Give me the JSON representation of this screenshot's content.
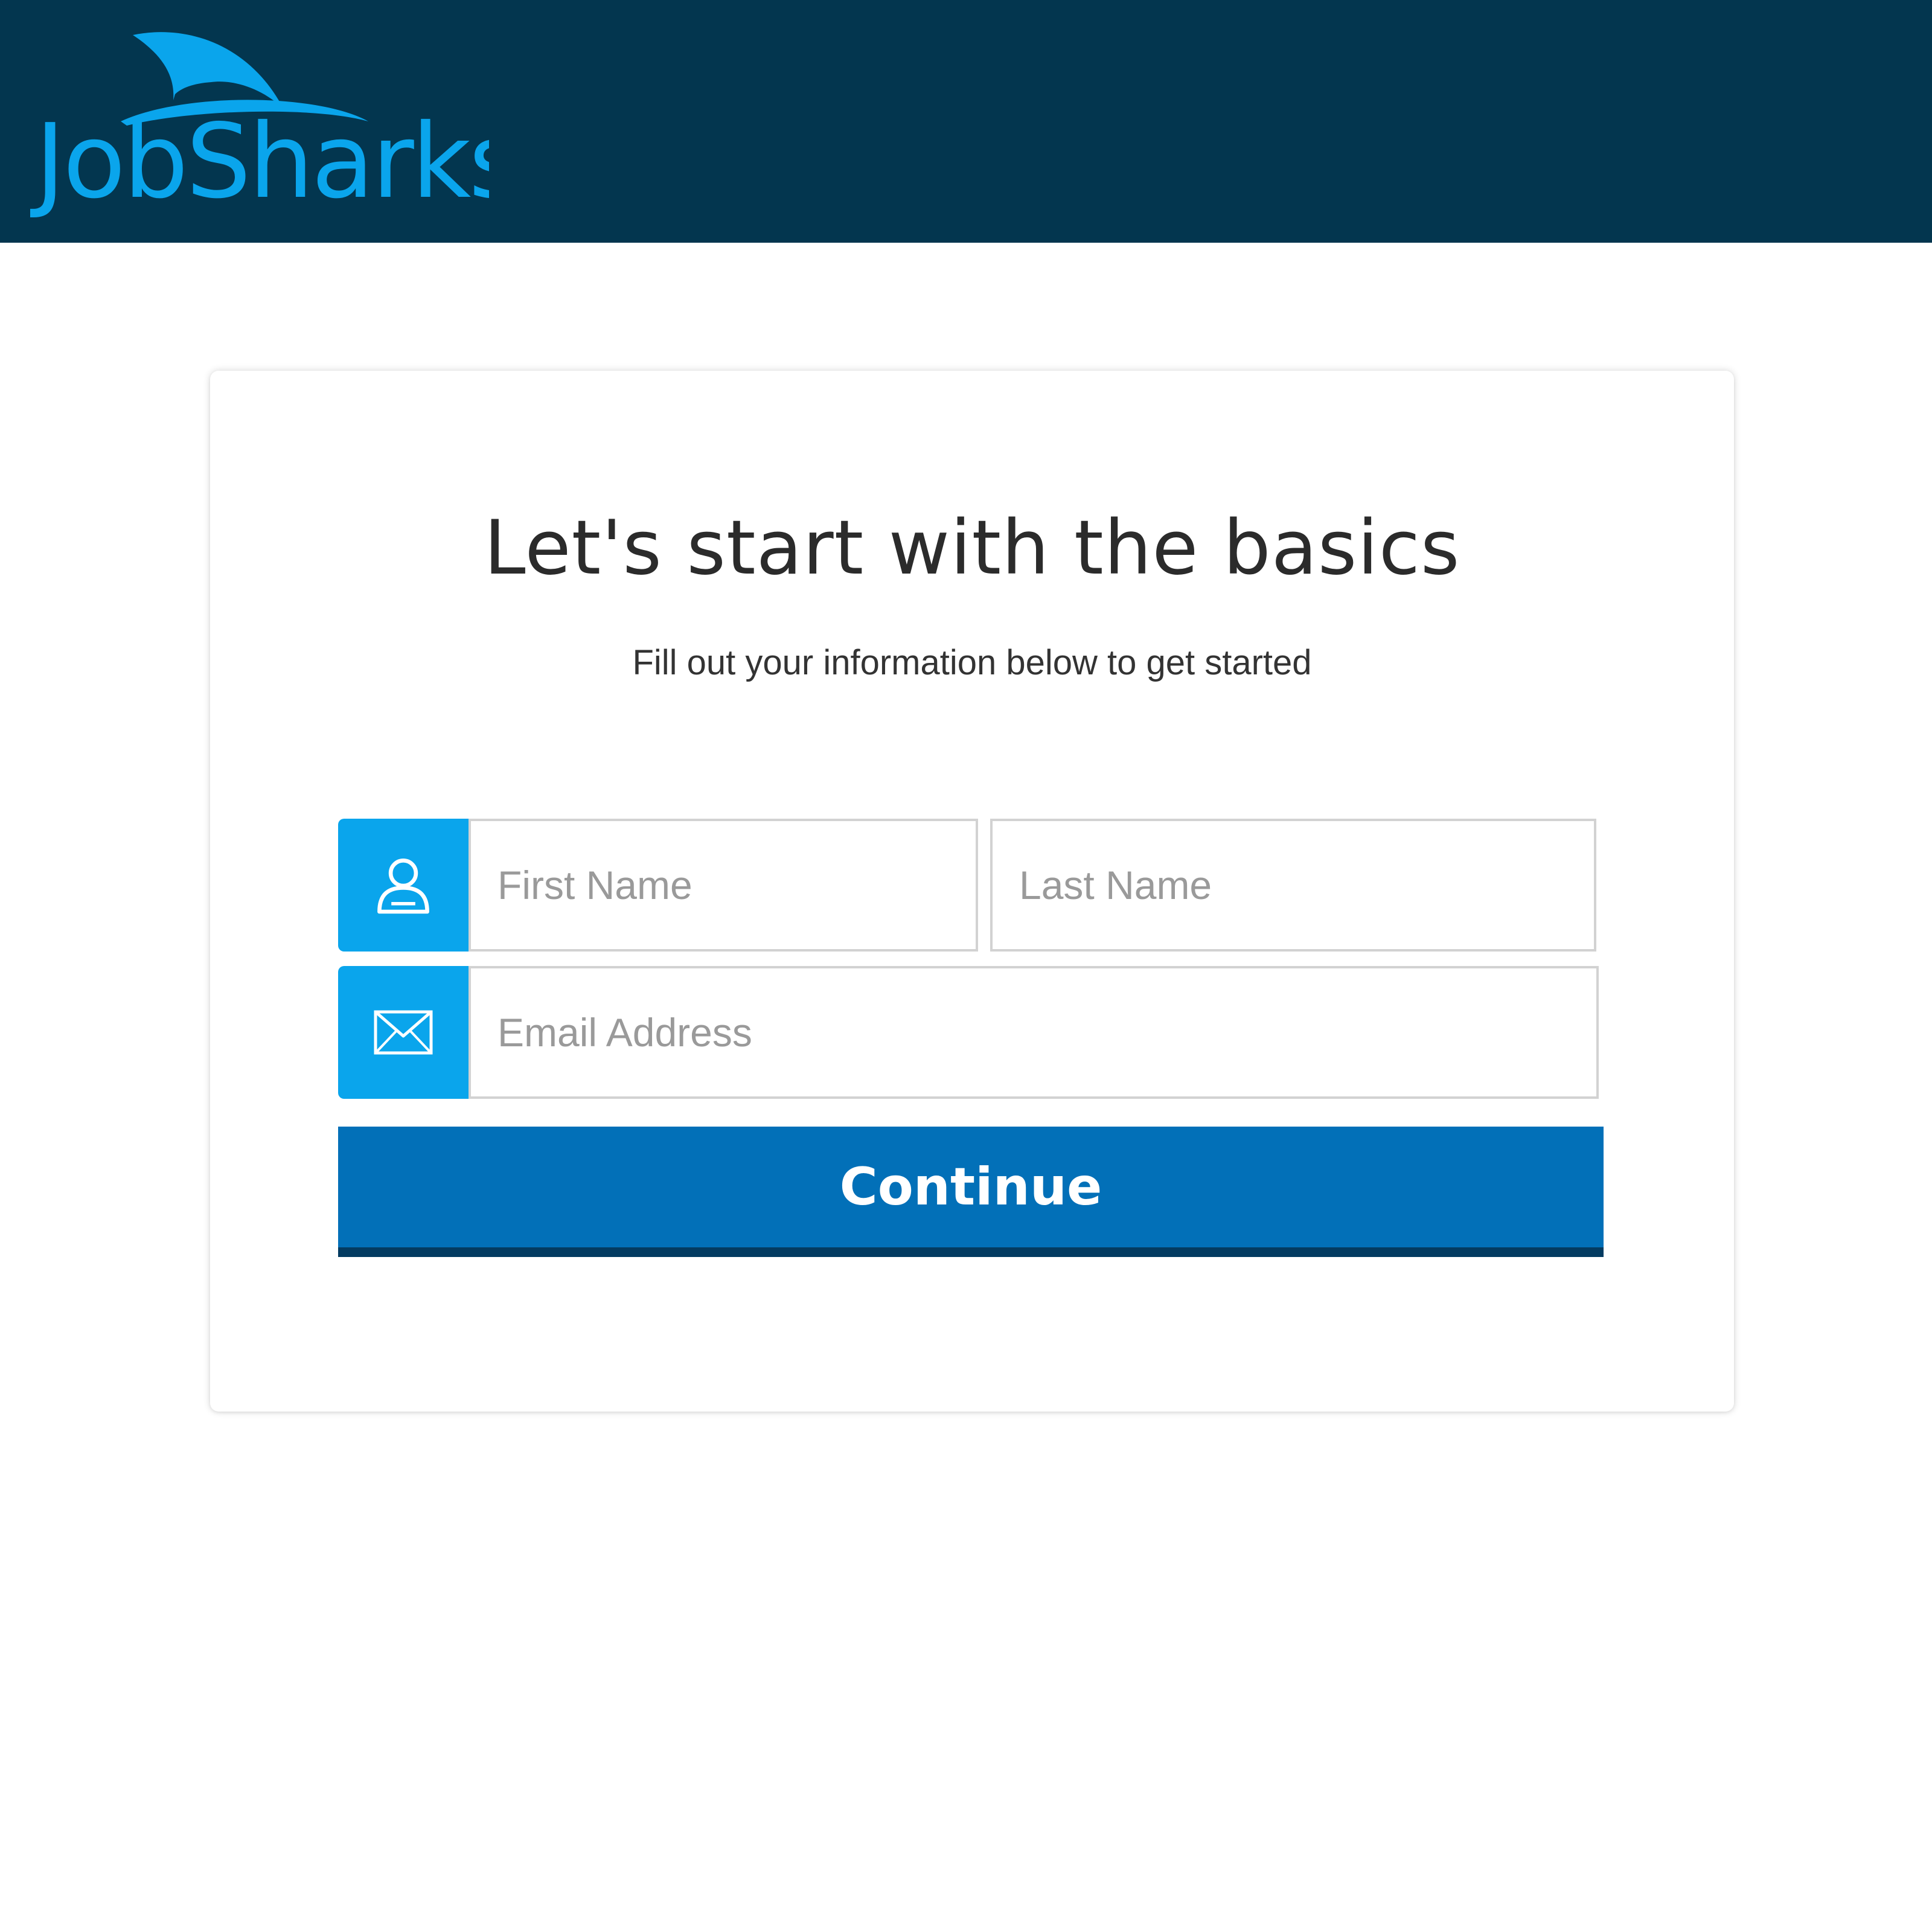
{
  "brand": {
    "logo_text": "JobSharks",
    "colors": {
      "header_bg": "#03364f",
      "logo": "#0aa5ec",
      "icon_bg": "#0aa5ec",
      "button": "#0270b8",
      "button_shadow": "#033b61"
    }
  },
  "form": {
    "title": "Let's start with the basics",
    "subtitle": "Fill out your information below to get started",
    "first_name": {
      "placeholder": "First Name",
      "value": "",
      "icon": "user-icon"
    },
    "last_name": {
      "placeholder": "Last Name",
      "value": ""
    },
    "email": {
      "placeholder": "Email Address",
      "value": "",
      "icon": "envelope-icon"
    },
    "continue_label": "Continue"
  }
}
